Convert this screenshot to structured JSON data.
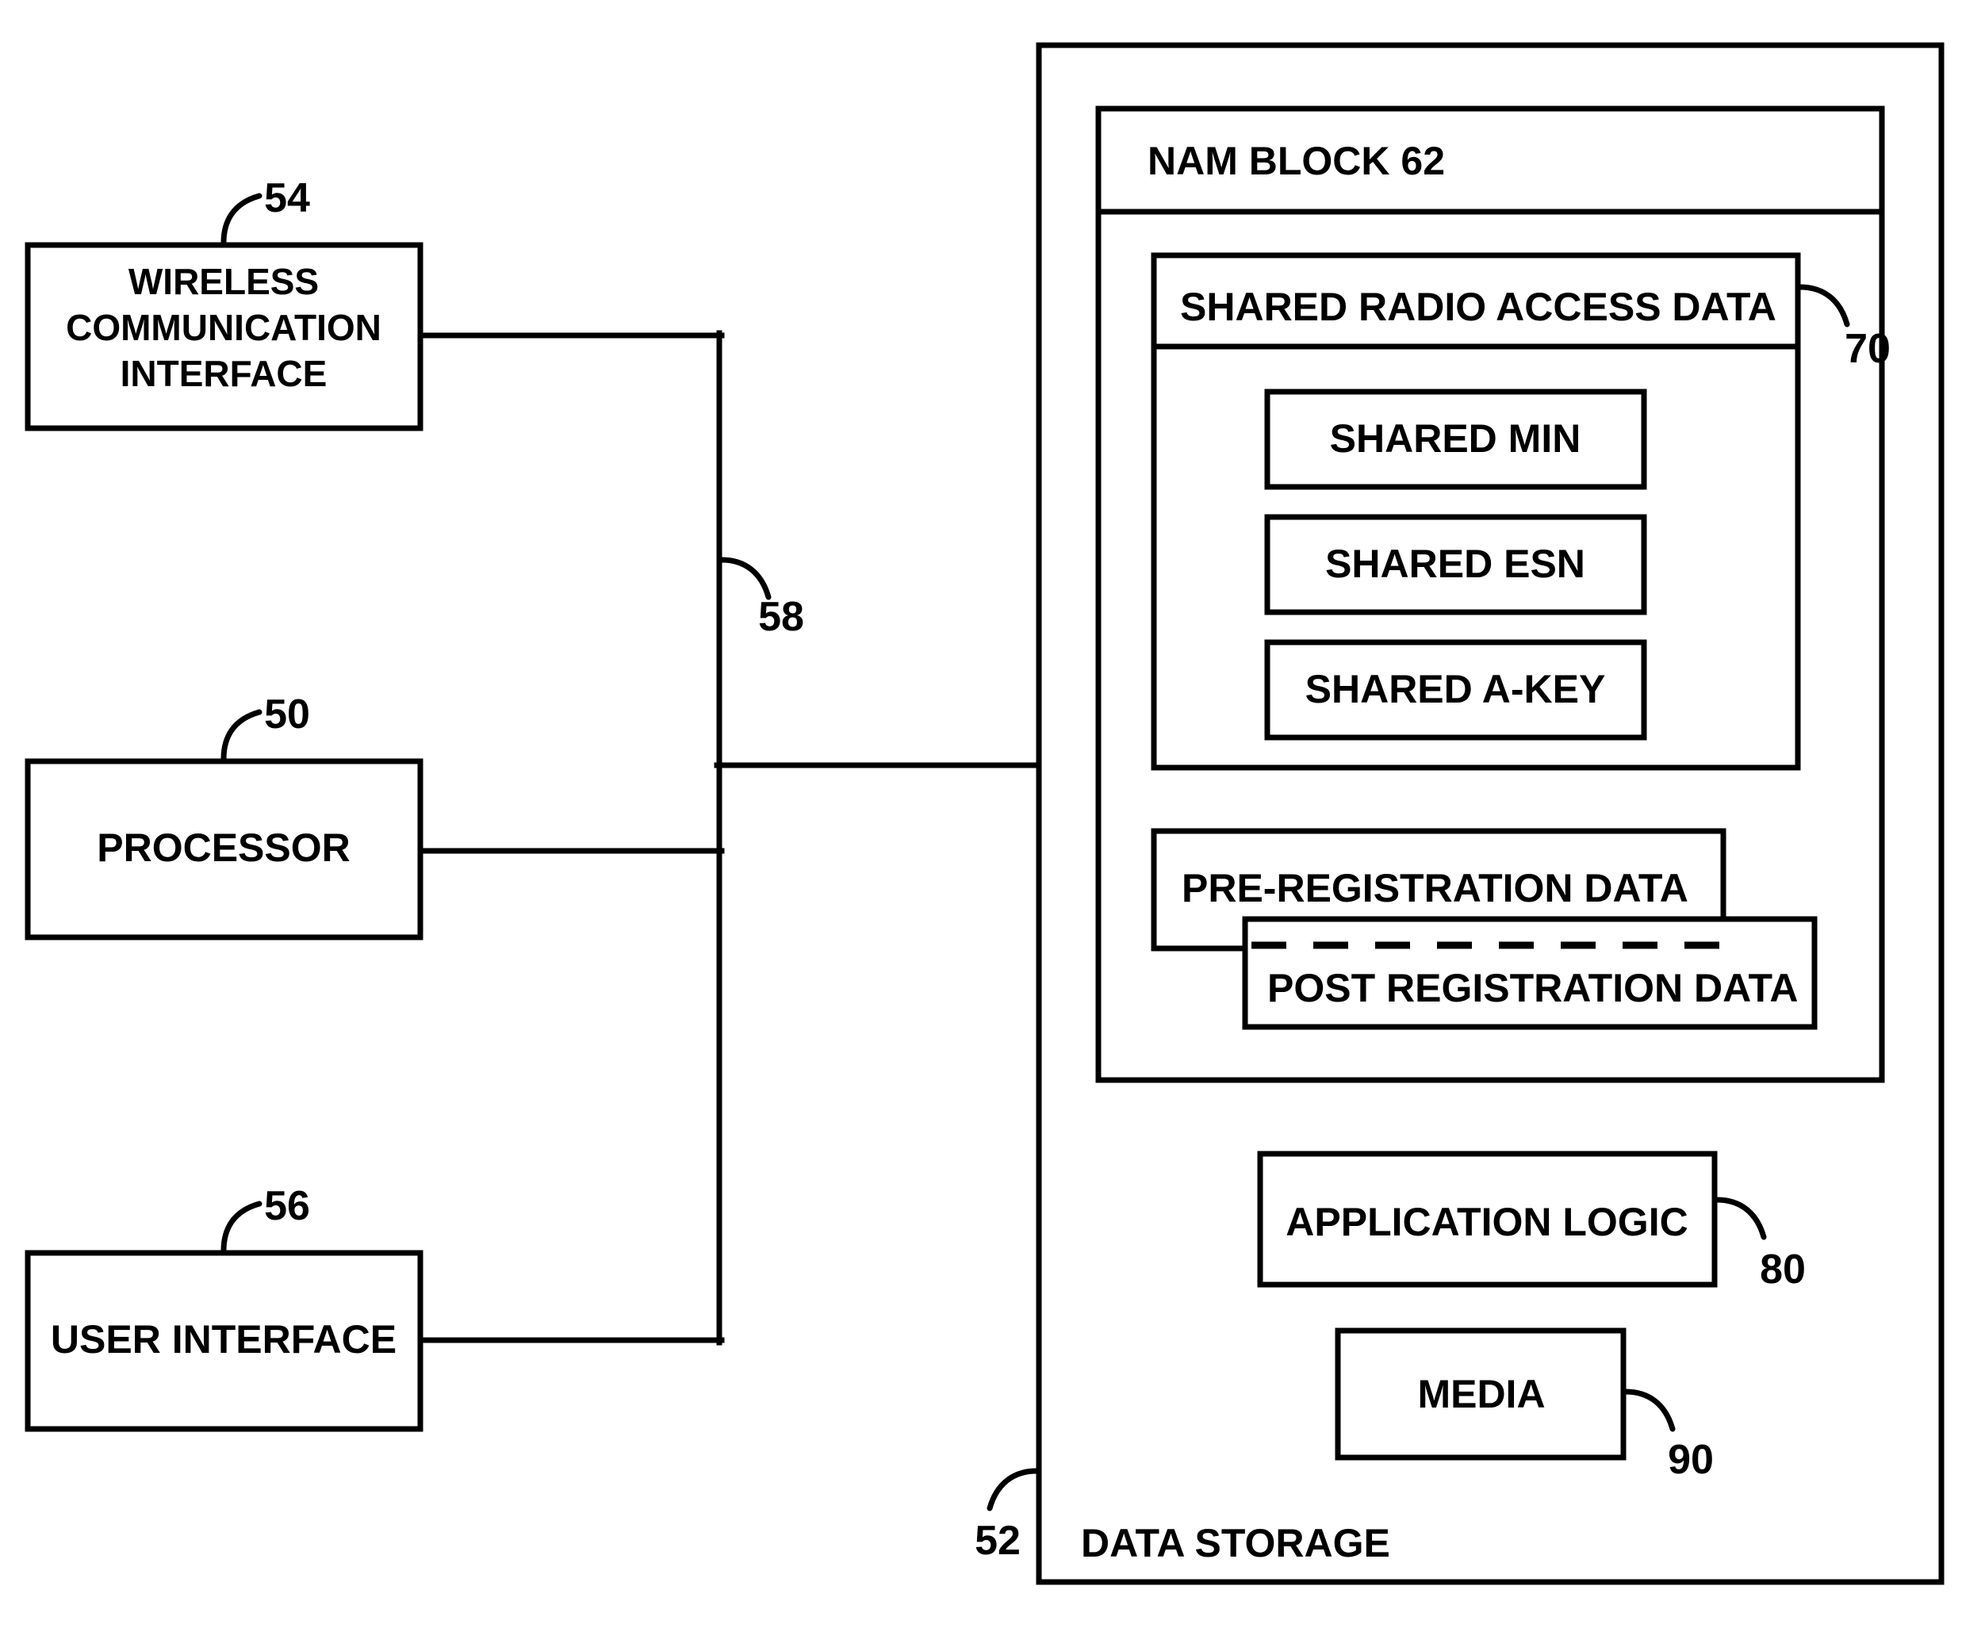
{
  "figure": {
    "type": "patent-block-diagram",
    "background_color": "#ffffff",
    "line_color": "#000000"
  },
  "left_column": {
    "blocks": [
      {
        "id": "wireless-communication-interface",
        "label_lines": [
          "WIRELESS",
          "COMMUNICATION",
          "INTERFACE"
        ],
        "reference_numeral": "54"
      },
      {
        "id": "processor",
        "label_lines": [
          "PROCESSOR"
        ],
        "reference_numeral": "50"
      },
      {
        "id": "user-interface",
        "label_lines": [
          "USER INTERFACE"
        ],
        "reference_numeral": "56"
      }
    ]
  },
  "bus": {
    "id": "system-bus",
    "reference_numeral": "58"
  },
  "data_storage": {
    "id": "data-storage",
    "label": "DATA STORAGE",
    "reference_numeral": "52",
    "nam_block": {
      "id": "nam-block",
      "header_label": "NAM BLOCK 62",
      "shared_radio_access_data": {
        "id": "shared-radio-access-data",
        "header_label": "SHARED RADIO ACCESS DATA",
        "reference_numeral": "70",
        "items": [
          {
            "id": "shared-min",
            "label": "SHARED MIN"
          },
          {
            "id": "shared-esn",
            "label": "SHARED ESN"
          },
          {
            "id": "shared-a-key",
            "label": "SHARED A-KEY"
          }
        ]
      },
      "registration_boxes": [
        {
          "id": "pre-registration-data",
          "label": "PRE-REGISTRATION DATA"
        },
        {
          "id": "post-registration-data",
          "label": "POST REGISTRATION DATA"
        }
      ]
    },
    "application_logic": {
      "id": "application-logic",
      "label": "APPLICATION LOGIC",
      "reference_numeral": "80"
    },
    "media": {
      "id": "media",
      "label": "MEDIA",
      "reference_numeral": "90"
    }
  }
}
